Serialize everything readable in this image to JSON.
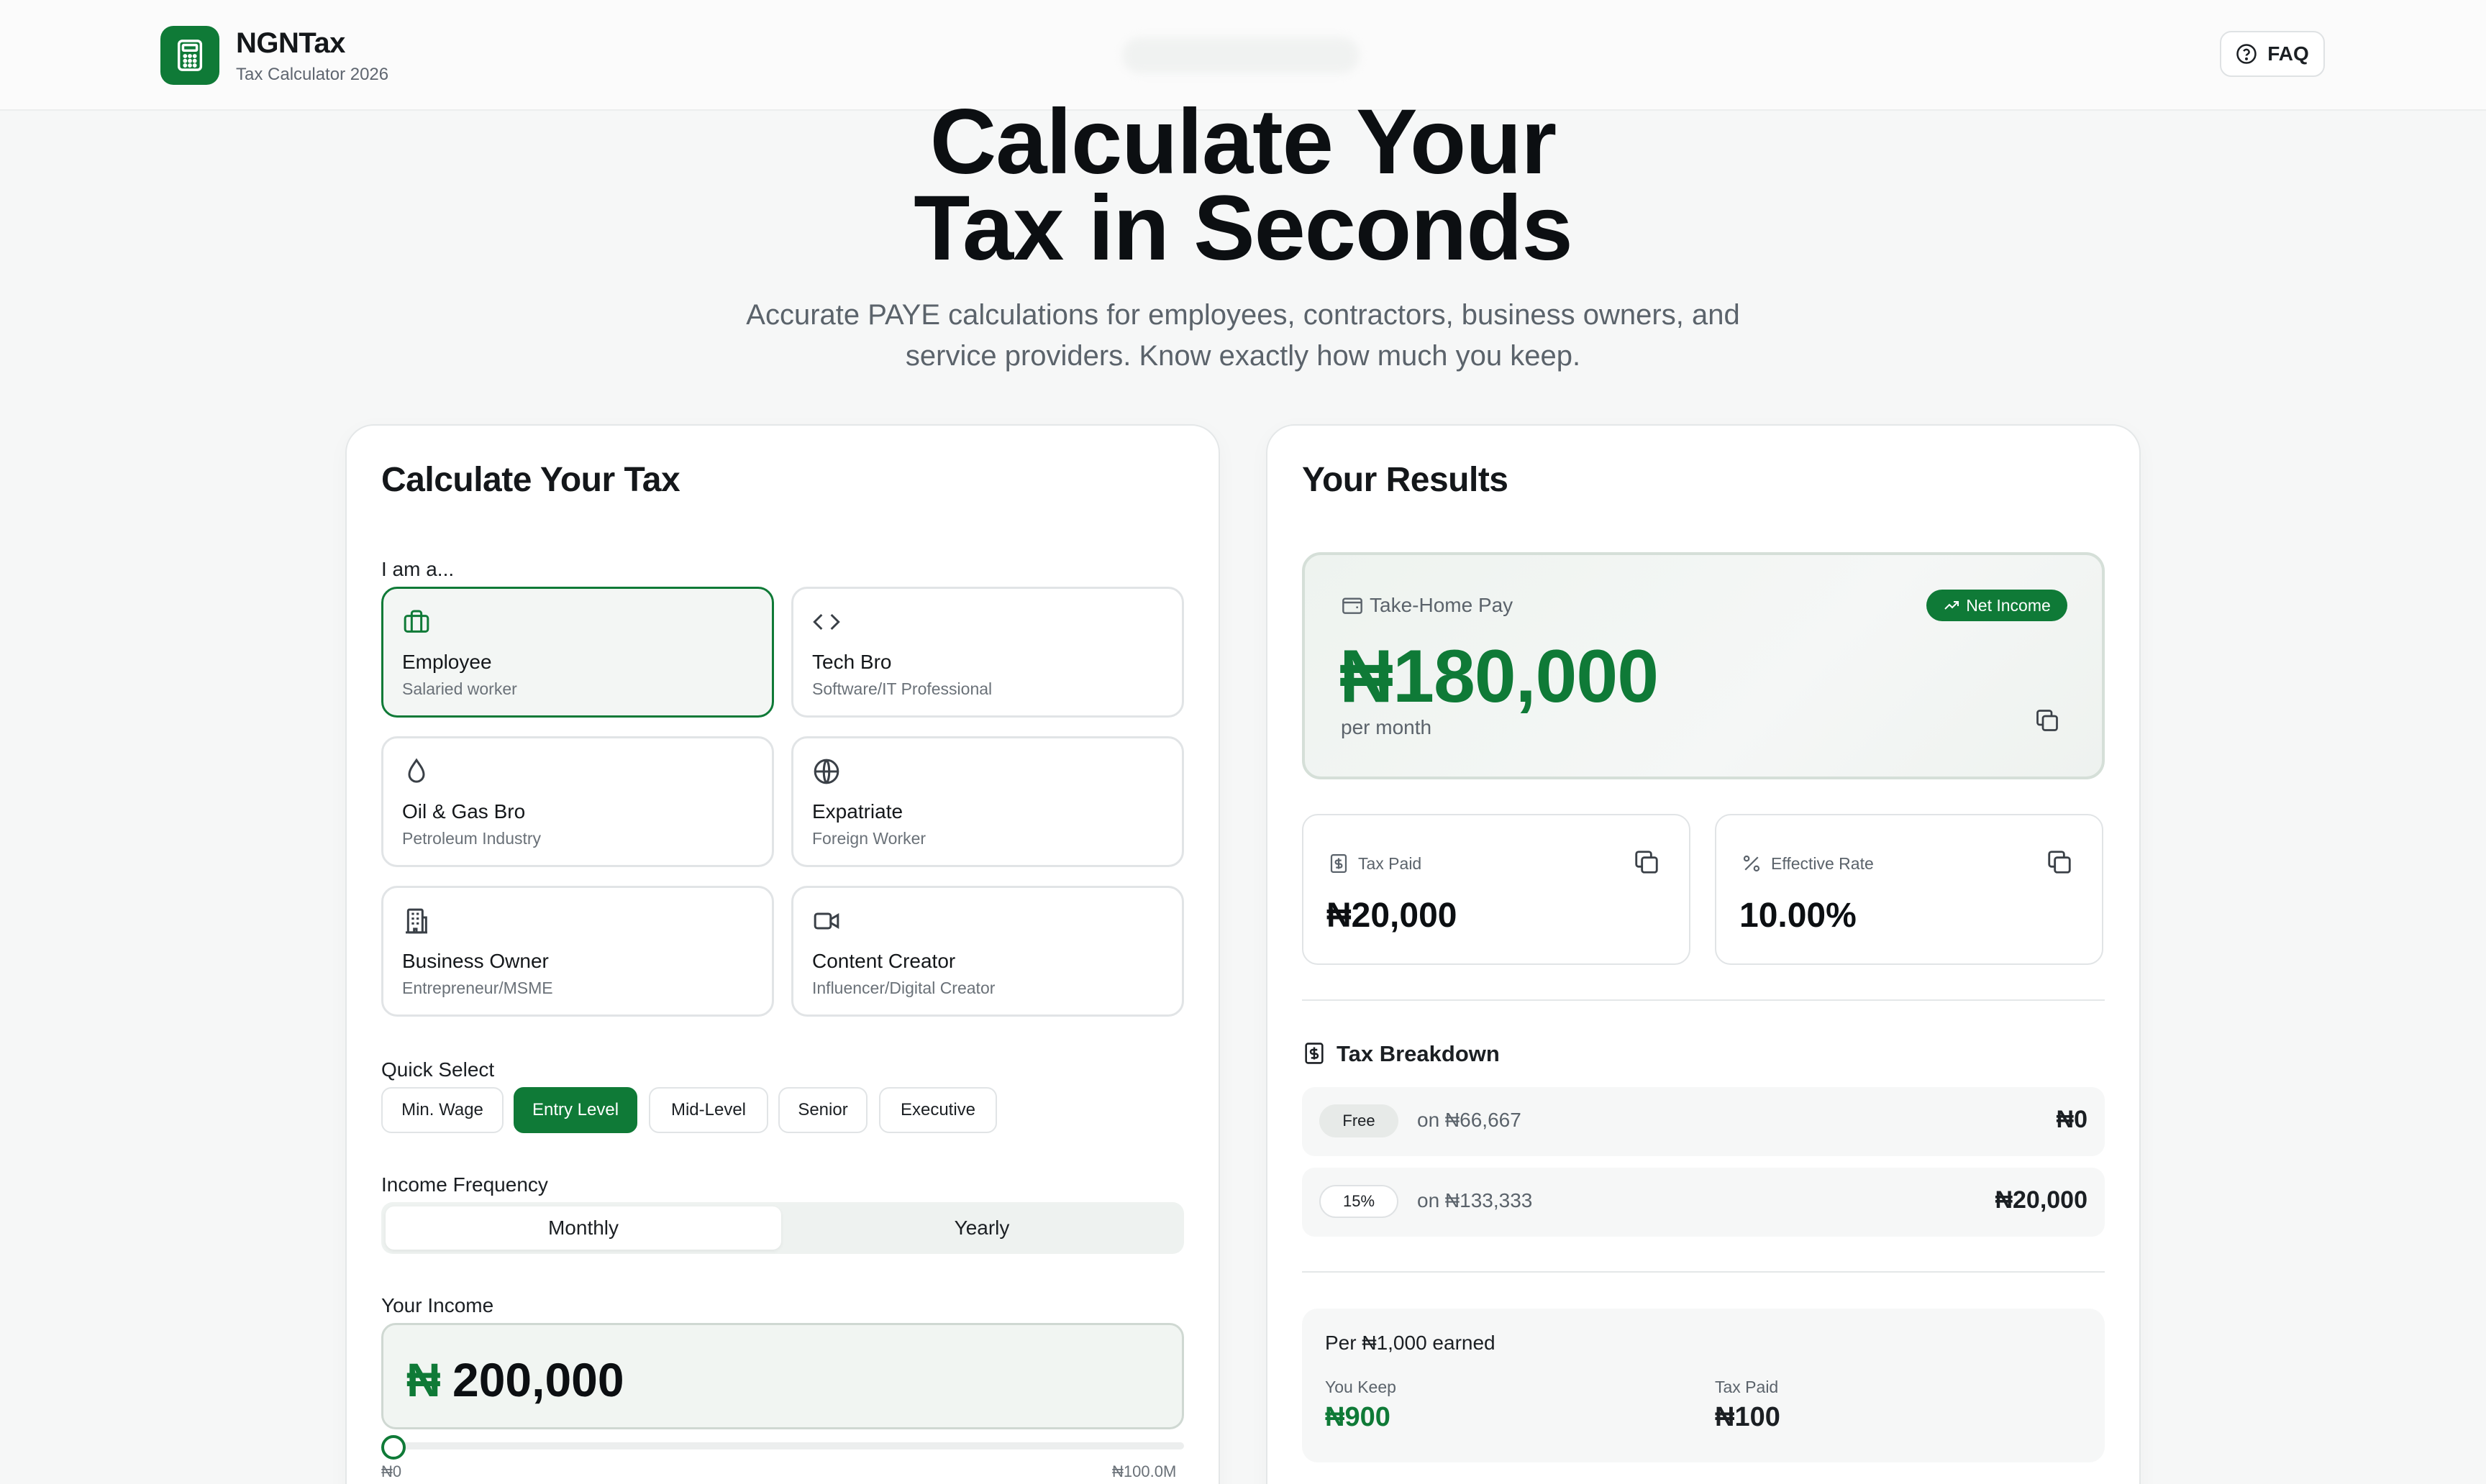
{
  "header": {
    "brand_name": "NGNTax",
    "brand_sub": "Tax Calculator 2026",
    "faq_label": "FAQ"
  },
  "hero": {
    "title_line1": "Calculate Your",
    "title_line2": "Tax in Seconds",
    "subtitle_line1": "Accurate PAYE calculations for employees, contractors, business owners, and",
    "subtitle_line2": "service providers. Know exactly how much you keep."
  },
  "calculator": {
    "title": "Calculate Your Tax",
    "role_label": "I am a...",
    "roles": [
      {
        "title": "Employee",
        "subtitle": "Salaried worker",
        "icon": "briefcase-icon",
        "selected": true
      },
      {
        "title": "Tech Bro",
        "subtitle": "Software/IT Professional",
        "icon": "code-icon",
        "selected": false
      },
      {
        "title": "Oil & Gas Bro",
        "subtitle": "Petroleum Industry",
        "icon": "droplet-icon",
        "selected": false
      },
      {
        "title": "Expatriate",
        "subtitle": "Foreign Worker",
        "icon": "globe-icon",
        "selected": false
      },
      {
        "title": "Business Owner",
        "subtitle": "Entrepreneur/MSME",
        "icon": "building-icon",
        "selected": false
      },
      {
        "title": "Content Creator",
        "subtitle": "Influencer/Digital Creator",
        "icon": "video-icon",
        "selected": false
      }
    ],
    "quick_select_label": "Quick Select",
    "quick_select": [
      {
        "label": "Min. Wage",
        "active": false
      },
      {
        "label": "Entry Level",
        "active": true
      },
      {
        "label": "Mid-Level",
        "active": false
      },
      {
        "label": "Senior",
        "active": false
      },
      {
        "label": "Executive",
        "active": false
      }
    ],
    "frequency_label": "Income Frequency",
    "frequency_options": [
      "Monthly",
      "Yearly"
    ],
    "frequency_selected": "Monthly",
    "income_label": "Your Income",
    "currency_symbol": "₦",
    "income_value": "200,000",
    "slider_min": "₦0",
    "slider_max": "₦100.0M",
    "slider_position": 0.0
  },
  "results": {
    "title": "Your Results",
    "take_home_label": "Take-Home Pay",
    "net_badge": "Net Income",
    "take_home_value": "₦180,000",
    "take_home_period": "per month",
    "tax_paid_label": "Tax Paid",
    "tax_paid_value": "₦20,000",
    "effective_rate_label": "Effective Rate",
    "effective_rate_value": "10.00%",
    "breakdown_title": "Tax Breakdown",
    "breakdown": [
      {
        "rate": "Free",
        "on": "on ₦66,667",
        "amount": "₦0"
      },
      {
        "rate": "15%",
        "on": "on ₦133,333",
        "amount": "₦20,000"
      }
    ],
    "per_thousand_title": "Per ₦1,000 earned",
    "you_keep_label": "You Keep",
    "you_keep_value": "₦900",
    "per_tax_label": "Tax Paid",
    "per_tax_value": "₦100"
  },
  "colors": {
    "accent": "#0f7a37",
    "accent_light_bg": "#f3f6f4",
    "text_dark": "#0c0f12",
    "text_muted": "#5b636b"
  }
}
